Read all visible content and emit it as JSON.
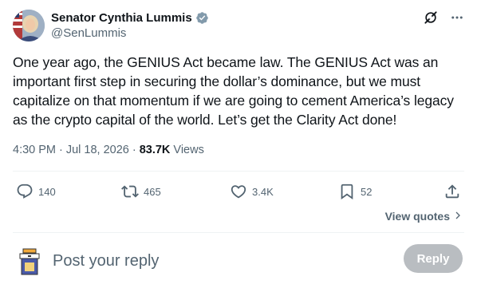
{
  "author": {
    "display_name": "Senator Cynthia Lummis",
    "handle": "@SenLummis"
  },
  "tweet": {
    "text": "One year ago, the GENIUS Act became law. The GENIUS Act was an important first step in securing the dollar’s dominance, but we must capitalize on that momentum if we are going to cement America’s legacy as the crypto capital of the world. Let’s get the Clarity Act done!",
    "time": "4:30 PM",
    "sep1": "·",
    "date": "Jul 18, 2026",
    "sep2": "·",
    "views_count": "83.7K",
    "views_label": "Views"
  },
  "actions": {
    "replies": "140",
    "reposts": "465",
    "likes": "3.4K",
    "bookmarks": "52"
  },
  "view_quotes": "View quotes",
  "reply": {
    "placeholder": "Post your reply",
    "button": "Reply"
  },
  "colors": {
    "verified": "#829aab",
    "secondary_text": "#536471",
    "reply_button_disabled": "#b9bdc1"
  },
  "icons": [
    "verified-badge-icon",
    "grok-icon",
    "more-icon",
    "reply-icon",
    "repost-icon",
    "like-icon",
    "bookmark-icon",
    "share-icon",
    "chevron-right-icon"
  ]
}
